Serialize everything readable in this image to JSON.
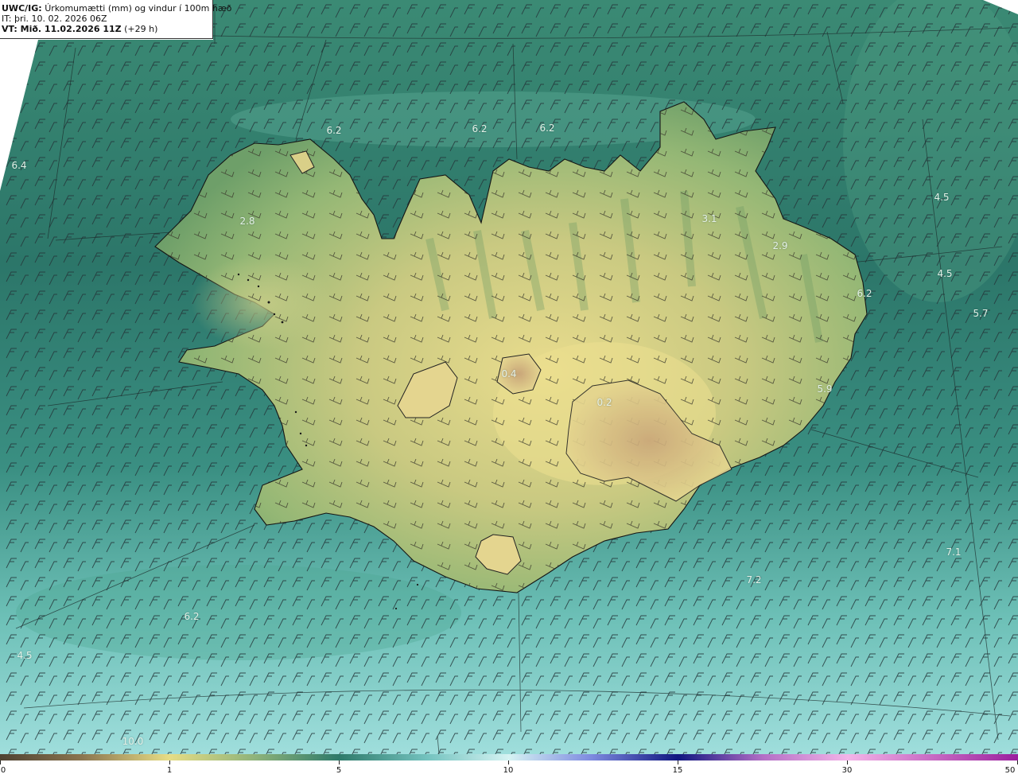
{
  "header": {
    "product": "UWC/IG:",
    "title": "Úrkomumætti (mm) og vindur í 100m hæð",
    "issue_time": "IT: þri. 10. 02. 2026 06Z",
    "valid_prefix": "VT: Mið. 11.02.2026 11Z",
    "valid_suffix": "(+29 h)"
  },
  "map_labels": [
    "6.2",
    "6.2",
    "6.2",
    "6.4",
    "2.8",
    "3.1",
    "2.9",
    "4.5",
    "4.5",
    "6.2",
    "5.7",
    "5.9",
    "7.1",
    "7.2",
    "6.2",
    "4.5",
    "10.0",
    "0.4",
    "0.2"
  ],
  "colorbar": {
    "ticks": [
      "0",
      "1",
      "5",
      "10",
      "15",
      "30",
      "50"
    ],
    "colors": [
      "#4f4232",
      "#a9905f",
      "#e7dd86",
      "#8fb37a",
      "#2e7a6a",
      "#74c3bf",
      "#d6f3f3",
      "#7f8be0",
      "#101680",
      "#b46fc6",
      "#f3b4e8",
      "#9b209e"
    ]
  },
  "colors": {
    "ocean": "#2f7d70",
    "ocean_south": "#6cc0b6",
    "land_low": "#7ea96d",
    "land_high": "#e2d98a",
    "coastline": "#1a1a1a",
    "grid_line": "#222222"
  }
}
